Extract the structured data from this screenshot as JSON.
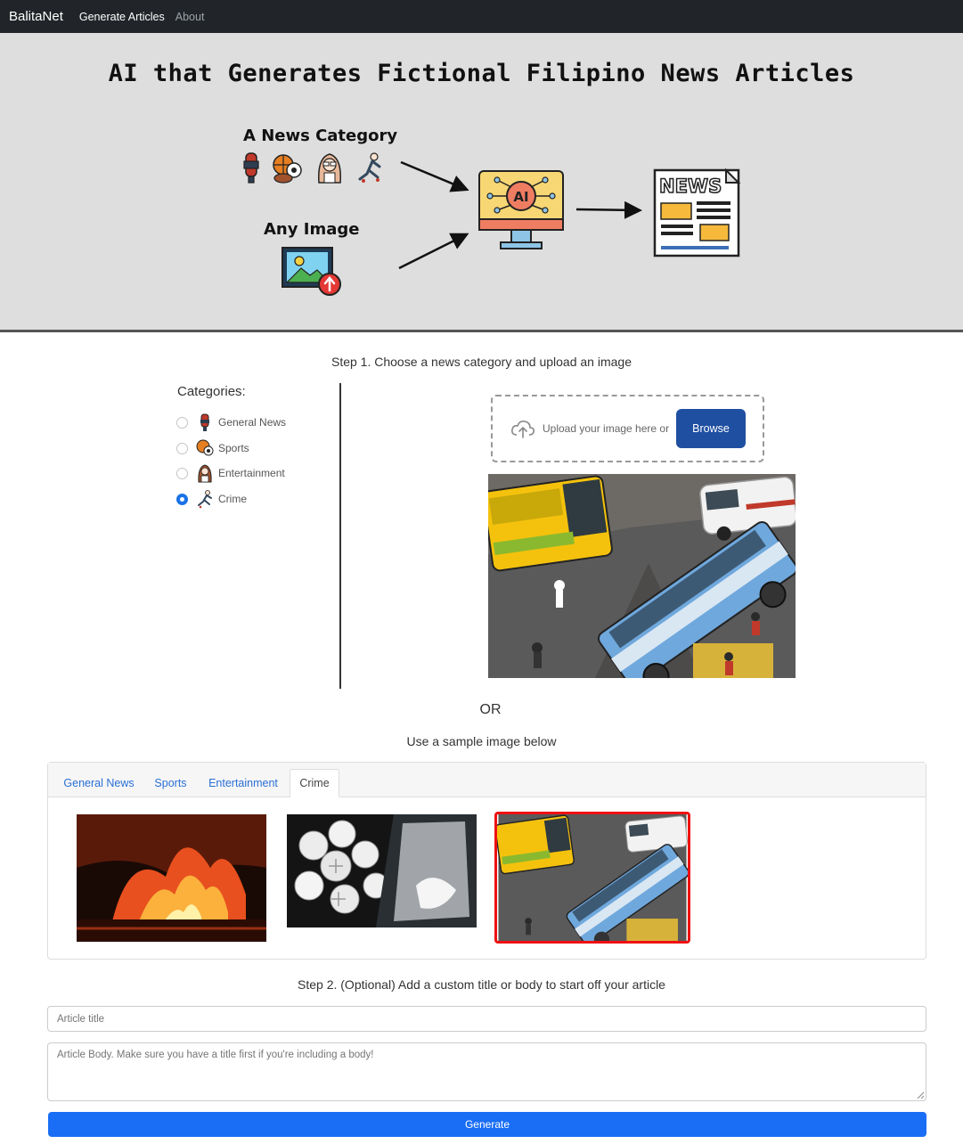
{
  "navbar": {
    "brand": "BalitaNet",
    "links": [
      {
        "label": "Generate Articles",
        "active": true
      },
      {
        "label": "About",
        "active": false
      }
    ]
  },
  "hero": {
    "title": "AI that Generates Fictional Filipino News Articles",
    "category_label": "A News Category",
    "image_label": "Any Image",
    "ai_chip_label": "AI",
    "news_label": "NEWS"
  },
  "step1": {
    "heading": "Step 1. Choose a news category and upload an image",
    "categories_title": "Categories:",
    "categories": [
      {
        "label": "General News",
        "icon": "microphone-icon",
        "checked": false
      },
      {
        "label": "Sports",
        "icon": "sports-balls-icon",
        "checked": false
      },
      {
        "label": "Entertainment",
        "icon": "celebrity-icon",
        "checked": false
      },
      {
        "label": "Crime",
        "icon": "crime-figure-icon",
        "checked": true
      }
    ],
    "upload": {
      "prompt": "Upload your image here or",
      "browse_label": "Browse"
    },
    "or_label": "OR",
    "sample_heading": "Use a sample image below"
  },
  "samples": {
    "tabs": [
      {
        "label": "General News",
        "active": false
      },
      {
        "label": "Sports",
        "active": false
      },
      {
        "label": "Entertainment",
        "active": false
      },
      {
        "label": "Crime",
        "active": true
      }
    ],
    "images": [
      {
        "subject": "fire-photo",
        "selected": false
      },
      {
        "subject": "drugs-photo",
        "selected": false
      },
      {
        "subject": "bus-accident-photo",
        "selected": true
      }
    ]
  },
  "step2": {
    "heading": "Step 2. (Optional) Add a custom title or body to start off your article",
    "title_placeholder": "Article title",
    "body_placeholder": "Article Body. Make sure you have a title first if you're including a body!",
    "generate_label": "Generate"
  },
  "colors": {
    "navbar_bg": "#212529",
    "hero_bg": "#dedede",
    "browse_bg": "#1f4fa1",
    "generate_bg": "#1a6ef5",
    "tab_link": "#2a6fd6",
    "selected_border": "#ee1111",
    "radio_checked": "#1a73e8"
  }
}
